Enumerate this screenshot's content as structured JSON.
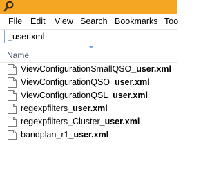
{
  "colors": {
    "titlebar": "#f5a623",
    "search_border": "#7aa7d8",
    "sort_arrow": "#6fa3d8"
  },
  "app": {
    "icon": "search-magnifier-icon"
  },
  "menu": {
    "items": [
      "File",
      "Edit",
      "View",
      "Search",
      "Bookmarks",
      "Too"
    ]
  },
  "search": {
    "value": "_user.xml"
  },
  "list": {
    "column_header": "Name",
    "files": [
      {
        "prefix": "ViewConfigurationSmallQSO",
        "match": "_user.xml"
      },
      {
        "prefix": "ViewConfigurationQSO",
        "match": "_user.xml"
      },
      {
        "prefix": "ViewConfigurationQSL",
        "match": "_user.xml"
      },
      {
        "prefix": "regexpfilters",
        "match": "_user.xml"
      },
      {
        "prefix": "regexpfilters_Cluster",
        "match": "_user.xml"
      },
      {
        "prefix": "bandplan_r1",
        "match": "_user.xml"
      }
    ],
    "file_icon": "document-icon"
  }
}
